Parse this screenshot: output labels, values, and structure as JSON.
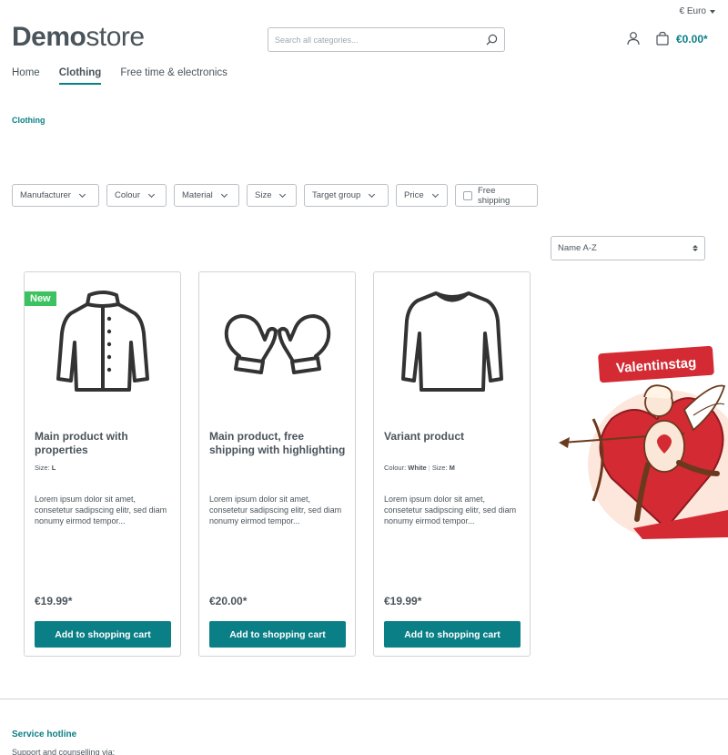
{
  "header": {
    "currency": "€ Euro",
    "logo_bold": "Demo",
    "logo_light": "store",
    "search_placeholder": "Search all categories...",
    "cart_total": "€0.00*"
  },
  "nav": {
    "items": [
      "Home",
      "Clothing",
      "Free time & electronics"
    ],
    "active": "Clothing"
  },
  "breadcrumb": "Clothing",
  "filters": {
    "manufacturer": "Manufacturer",
    "colour": "Colour",
    "material": "Material",
    "size": "Size",
    "target_group": "Target group",
    "price": "Price",
    "free_shipping": "Free shipping"
  },
  "sort": {
    "selected": "Name A-Z"
  },
  "products": [
    {
      "badge": "New",
      "name": "Main product with properties",
      "props": [
        {
          "label": "Size:",
          "value": "L"
        }
      ],
      "description": "Lorem ipsum dolor sit amet, consetetur sadipscing elitr, sed diam nonumy eirmod tempor...",
      "price": "€19.99*",
      "button": "Add to shopping cart",
      "icon": "jacket-icon"
    },
    {
      "name": "Main product, free shipping with highlighting",
      "props": [],
      "description": "Lorem ipsum dolor sit amet, consetetur sadipscing elitr, sed diam nonumy eirmod tempor...",
      "price": "€20.00*",
      "button": "Add to shopping cart",
      "icon": "mittens-icon"
    },
    {
      "name": "Variant product",
      "props": [
        {
          "label": "Colour:",
          "value": "White"
        },
        {
          "label": "Size:",
          "value": "M"
        }
      ],
      "description": "Lorem ipsum dolor sit amet, consetetur sadipscing elitr, sed diam nonumy eirmod tempor...",
      "price": "€19.99*",
      "button": "Add to shopping cart",
      "icon": "sweater-icon"
    }
  ],
  "promo": {
    "label": "Valentinstag"
  },
  "footer": {
    "hotline_title": "Service hotline",
    "support_text": "Support and counselling via:"
  },
  "colors": {
    "accent": "#0b7f86",
    "badge_new": "#3cc261",
    "promo_red": "#d42a33"
  }
}
